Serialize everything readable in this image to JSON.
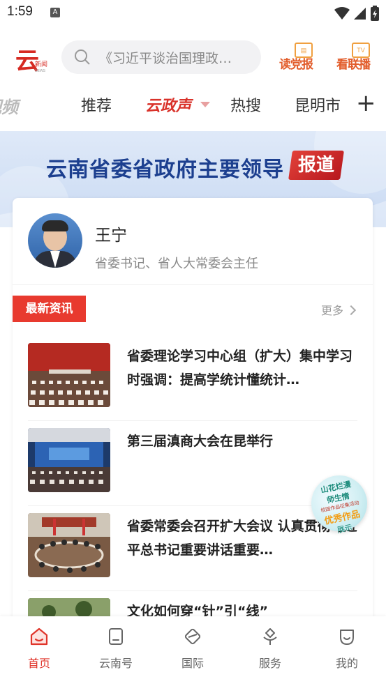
{
  "status_bar": {
    "time": "1:59",
    "notif_icon": "A"
  },
  "header": {
    "logo_char": "云",
    "logo_sub": "新闻",
    "search_placeholder": "《习近平谈治国理政…",
    "btn_read": {
      "label": "读党报",
      "tag": ""
    },
    "btn_live": {
      "label": "看联播",
      "tag": "TV"
    }
  },
  "tabs": [
    {
      "label": "视频"
    },
    {
      "label": "推荐"
    },
    {
      "label": "云政声"
    },
    {
      "label": "热搜"
    },
    {
      "label": "昆明市"
    }
  ],
  "tab_add": "+",
  "banner": {
    "title": "云南省委省政府主要领导",
    "tag": "报道"
  },
  "leader": {
    "name": "王宁",
    "title": "省委书记、省人大常委会主任"
  },
  "news_section": {
    "badge": "最新资讯",
    "more": "更多"
  },
  "news": [
    {
      "title": "省委理论学习中心组（扩大）集中学习时强调：提高学统计懂统计…"
    },
    {
      "title": "第三届滇商大会在昆举行"
    },
    {
      "title": "省委常委会召开扩大会议 认真贯彻习近平总书记重要讲话重要…"
    },
    {
      "title": "文化如何穿“针”引“线”"
    }
  ],
  "float_badge": {
    "l1": "山花烂漫",
    "l2": "师生情",
    "l3": "校园作品征集活动",
    "l4": "优秀作品",
    "l5": "展示"
  },
  "bottom_nav": [
    {
      "label": "首页",
      "active": true
    },
    {
      "label": "云南号"
    },
    {
      "label": "国际"
    },
    {
      "label": "服务"
    },
    {
      "label": "我的"
    }
  ],
  "colors": {
    "accent": "#e0342a",
    "banner_text": "#1c3f8f"
  }
}
